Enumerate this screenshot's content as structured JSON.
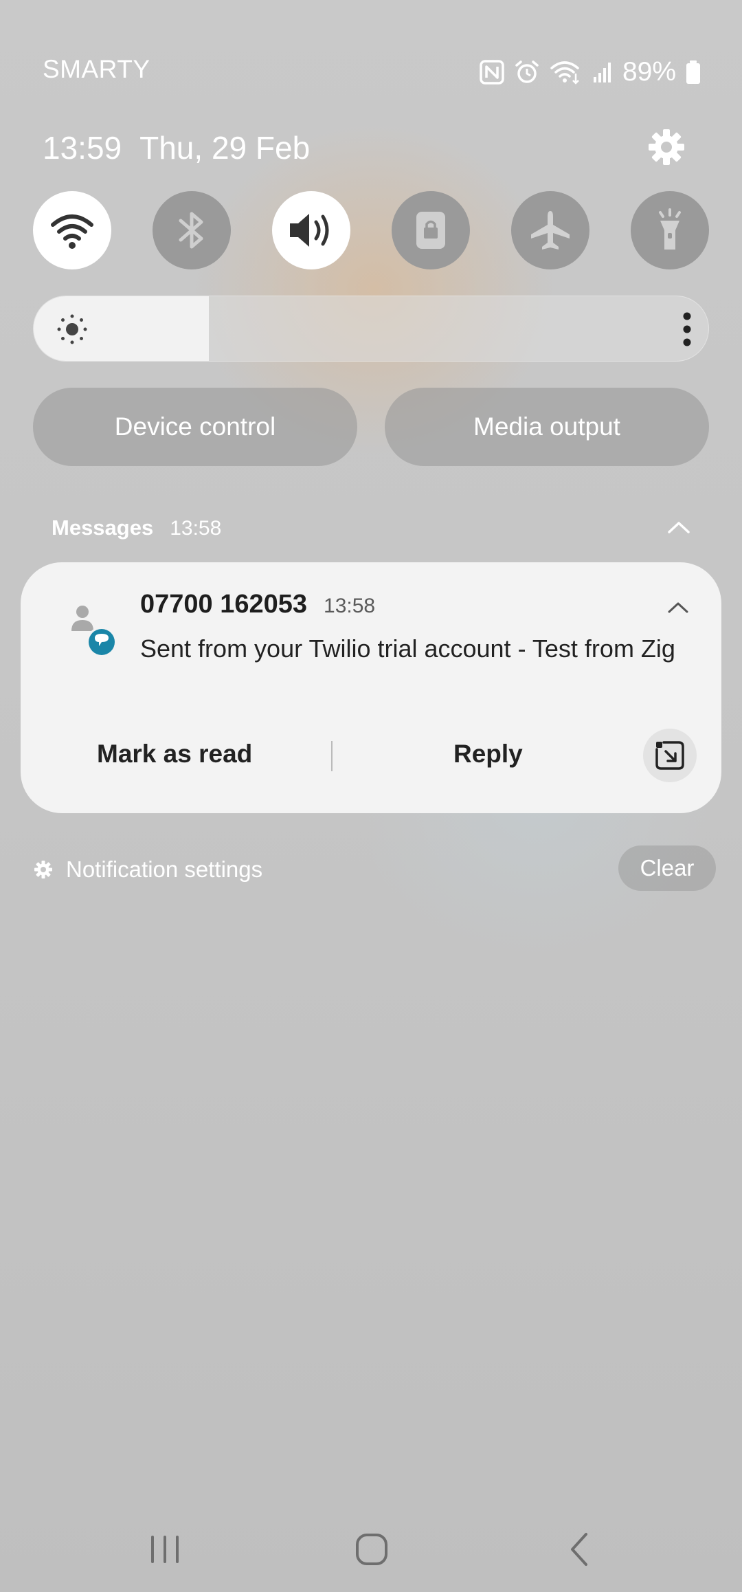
{
  "status_bar": {
    "carrier": "SMARTY",
    "battery_percent": "89%",
    "icons": [
      "nfc-icon",
      "alarm-icon",
      "wifi-calling-icon",
      "signal-icon",
      "battery-icon"
    ]
  },
  "header": {
    "time": "13:59",
    "date": "Thu, 29 Feb"
  },
  "quick_toggles": [
    {
      "name": "wifi",
      "on": true
    },
    {
      "name": "bluetooth",
      "on": false
    },
    {
      "name": "sound",
      "on": true
    },
    {
      "name": "screen-lock",
      "on": false
    },
    {
      "name": "airplane-mode",
      "on": false
    },
    {
      "name": "flashlight",
      "on": false
    }
  ],
  "brightness": {
    "level": 0.26
  },
  "buttons": {
    "device_control": "Device control",
    "media_output": "Media output"
  },
  "notification_group": {
    "app": "Messages",
    "time": "13:58"
  },
  "notification": {
    "sender": "07700 162053",
    "time": "13:58",
    "body": "Sent from your Twilio trial account - Test from Zig",
    "actions": {
      "mark_read": "Mark as read",
      "reply": "Reply"
    }
  },
  "footer": {
    "settings_label": "Notification settings",
    "clear_label": "Clear"
  },
  "colors": {
    "accent_badge": "#1a86a8",
    "toggle_on": "#ffffff",
    "toggle_off": "#9a9a9a",
    "card_bg": "#f3f3f3"
  }
}
